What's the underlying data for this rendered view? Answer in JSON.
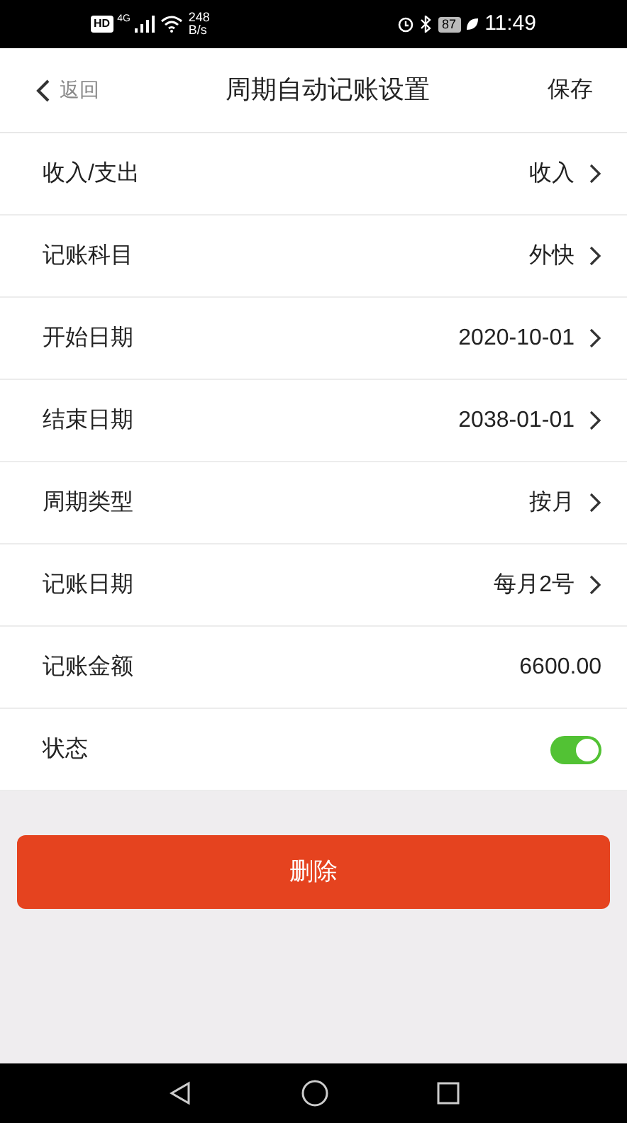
{
  "status_bar": {
    "hd": "HD",
    "network": "4G",
    "speed": "248",
    "speed_unit": "B/s",
    "battery": "87",
    "time": "11:49"
  },
  "header": {
    "back": "返回",
    "title": "周期自动记账设置",
    "save": "保存"
  },
  "rows": [
    {
      "kind": "link",
      "label": "收入/支出",
      "value": "收入"
    },
    {
      "kind": "link",
      "label": "记账科目",
      "value": "外快"
    },
    {
      "kind": "link",
      "label": "开始日期",
      "value": "2020-10-01"
    },
    {
      "kind": "link",
      "label": "结束日期",
      "value": "2038-01-01"
    },
    {
      "kind": "link",
      "label": "周期类型",
      "value": "按月"
    },
    {
      "kind": "link",
      "label": "记账日期",
      "value": "每月2号"
    },
    {
      "kind": "value",
      "label": "记账金额",
      "value": "6600.00"
    },
    {
      "kind": "toggle",
      "label": "状态",
      "on": true
    }
  ],
  "delete_button": "删除"
}
